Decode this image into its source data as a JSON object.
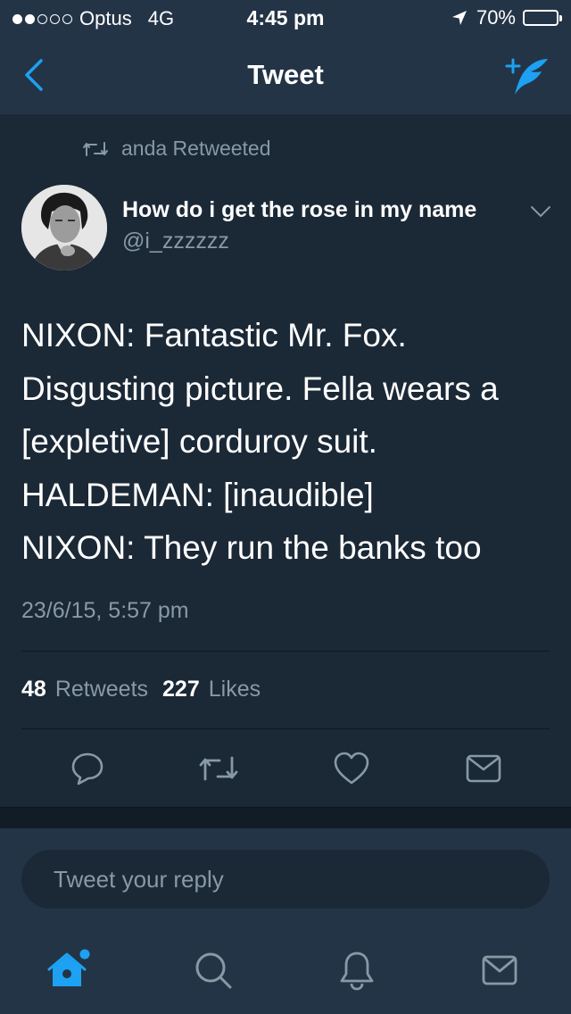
{
  "status_bar": {
    "carrier": "Optus",
    "network": "4G",
    "time": "4:45 pm",
    "battery": "70%",
    "signal_bars_filled": 2,
    "signal_bars_total": 5,
    "battery_level": 0.7
  },
  "nav": {
    "title": "Tweet",
    "back_icon": "chevron-left-icon",
    "compose_icon": "compose-tweet-icon"
  },
  "tweet": {
    "retweeted_by": "anda Retweeted",
    "user_name": "How do i get the rose in my name",
    "handle": "@i_zzzzzz",
    "text_lines": [
      "NIXON: Fantastic Mr. Fox.",
      "Disgusting picture. Fella wears a",
      "[expletive] corduroy suit.",
      "HALDEMAN: [inaudible]",
      "NIXON: They run the banks too"
    ],
    "timestamp": "23/6/15, 5:57 pm",
    "retweets_count": "48",
    "retweets_label": "Retweets",
    "likes_count": "227",
    "likes_label": "Likes"
  },
  "actions": [
    "reply-icon",
    "retweet-icon",
    "like-icon",
    "message-icon"
  ],
  "reply": {
    "placeholder": "Tweet your reply"
  },
  "tabbar": [
    "home-icon",
    "search-icon",
    "notifications-icon",
    "messages-icon"
  ],
  "colors": {
    "accent": "#1da1f2",
    "background": "#1b2836",
    "header": "#243447",
    "muted": "#8899a6"
  }
}
